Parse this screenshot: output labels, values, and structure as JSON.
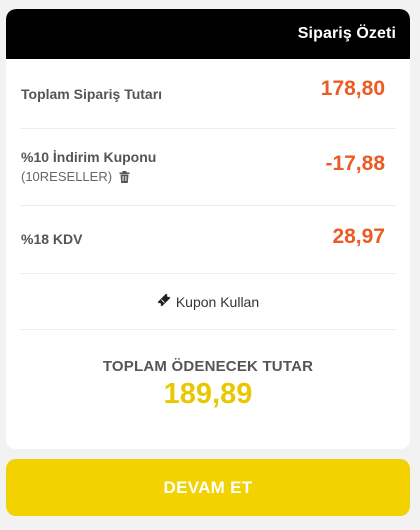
{
  "summary": {
    "title": "Sipariş Özeti",
    "order_total_label": "Toplam Sipariş Tutarı",
    "order_total_value": "178,80",
    "discount_label": "%10 İndirim Kuponu",
    "coupon_code": "(10RESELLER)",
    "discount_value": "-17,88",
    "vat_label": "%18 KDV",
    "vat_value": "28,97",
    "coupon_link": "Kupon Kullan",
    "grand_total_label": "TOPLAM ÖDENECEK TUTAR",
    "grand_total_value": "189,89"
  },
  "actions": {
    "continue_label": "DEVAM ET"
  },
  "icons": {
    "remove_coupon": "trash-icon",
    "coupon": "ticket-icon"
  },
  "colors": {
    "header_bg": "#000000",
    "amount": "#ec5b24",
    "grand_total": "#e8c800",
    "button_bg": "#f2d200"
  }
}
